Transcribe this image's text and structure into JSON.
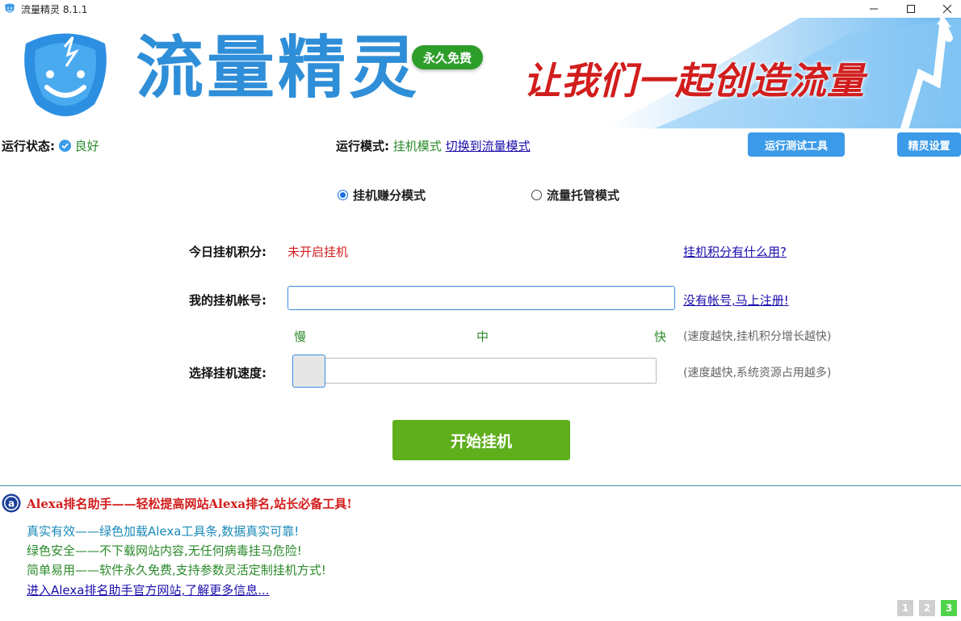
{
  "window": {
    "title": "流量精灵 8.1.1"
  },
  "banner": {
    "logo_text": "流量精灵",
    "badge": "永久免费",
    "slogan": "让我们一起创造流量"
  },
  "status": {
    "run_status_label": "运行状态:",
    "run_status_value": "良好",
    "run_mode_label": "运行模式:",
    "run_mode_value": "挂机模式",
    "switch_link": "切换到流量模式"
  },
  "toolbar": {
    "test_tool": "运行测试工具",
    "settings": "精灵设置"
  },
  "modes": [
    {
      "label": "挂机赚分模式",
      "selected": true
    },
    {
      "label": "流量托管模式",
      "selected": false
    }
  ],
  "form": {
    "points_label": "今日挂机积分:",
    "points_value": "未开启挂机",
    "points_help": "挂机积分有什么用?",
    "account_label": "我的挂机帐号:",
    "account_value": "",
    "register_link": "没有帐号,马上注册!",
    "speed_label": "选择挂机速度:",
    "speed_ticks": [
      "慢",
      "中",
      "快"
    ],
    "speed_hint_1": "(速度越快,挂机积分增长越快)",
    "speed_hint_2": "(速度越快,系统资源占用越多)",
    "speed_level": 0,
    "start_button": "开始挂机"
  },
  "alexa": {
    "title": "Alexa排名助手——轻松提高网站Alexa排名,站长必备工具!",
    "features": [
      "真实有效——绿色加载Alexa工具条,数据真实可靠!",
      "绿色安全——不下载网站内容,无任何病毒挂马危险!",
      "简单易用——软件永久免费,支持参数灵活定制挂机方式!"
    ],
    "more_link": "进入Alexa排名助手官方网站,了解更多信息..."
  },
  "pager": {
    "pages": [
      "1",
      "2",
      "3"
    ],
    "active": "3",
    "inactive_color": "#cfcfcf",
    "active_color": "#4fd44a"
  },
  "colors": {
    "accent_blue": "#3b9be8",
    "start_green": "#5fae1c",
    "status_green": "#2a8a2a",
    "alert_red": "#d21d1d"
  }
}
